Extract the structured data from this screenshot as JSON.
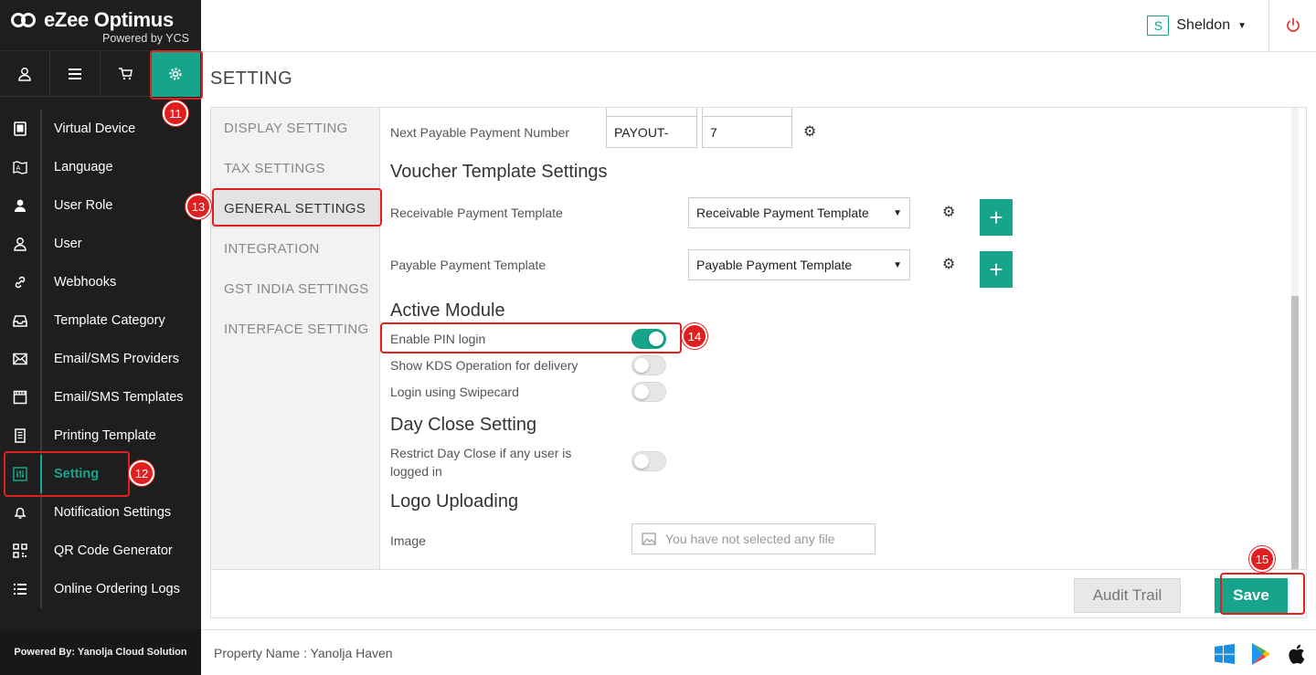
{
  "app": {
    "brand": "eZee Optimus",
    "powered_by": "Powered by YCS",
    "footer": "Powered By: Yanolja Cloud Solution"
  },
  "iconbar": [
    "user-icon",
    "list-icon",
    "cart-icon",
    "gear-icon"
  ],
  "menu": [
    {
      "label": "Virtual Device",
      "icon": "tablet-icon"
    },
    {
      "label": "Language",
      "icon": "language-icon"
    },
    {
      "label": "User Role",
      "icon": "user-role-icon"
    },
    {
      "label": "User",
      "icon": "user-icon"
    },
    {
      "label": "Webhooks",
      "icon": "link-icon"
    },
    {
      "label": "Template Category",
      "icon": "inbox-icon"
    },
    {
      "label": "Email/SMS Providers",
      "icon": "envelope-icon"
    },
    {
      "label": "Email/SMS Templates",
      "icon": "film-icon"
    },
    {
      "label": "Printing Template",
      "icon": "receipt-icon"
    },
    {
      "label": "Setting",
      "icon": "sliders-icon",
      "active": true
    },
    {
      "label": "Notification Settings",
      "icon": "bell-icon"
    },
    {
      "label": "QR Code Generator",
      "icon": "qr-icon"
    },
    {
      "label": "Online Ordering Logs",
      "icon": "list-icon"
    }
  ],
  "topbar": {
    "user_initial": "S",
    "user_name": "Sheldon"
  },
  "page_title": "SETTING",
  "tabs": [
    {
      "label": "DISPLAY SETTING"
    },
    {
      "label": "TAX SETTINGS"
    },
    {
      "label": "GENERAL SETTINGS",
      "active": true
    },
    {
      "label": "INTEGRATION"
    },
    {
      "label": "GST INDIA SETTINGS"
    },
    {
      "label": "INTERFACE SETTING"
    }
  ],
  "content": {
    "next_payable": {
      "label": "Next Payable Payment Number",
      "prefix": "PAYOUT-",
      "number": "7"
    },
    "voucher_title": "Voucher Template Settings",
    "receivable": {
      "label": "Receivable Payment Template",
      "value": "Receivable Payment Template"
    },
    "payable": {
      "label": "Payable Payment Template",
      "value": "Payable Payment Template"
    },
    "active_module_title": "Active Module",
    "pin_login": {
      "label": "Enable PIN login",
      "on": true
    },
    "kds": {
      "label": "Show KDS Operation for delivery",
      "on": false
    },
    "swipecard": {
      "label": "Login using Swipecard",
      "on": false
    },
    "day_close_title": "Day Close Setting",
    "restrict_day_close": {
      "label_line1": "Restrict Day Close if any user is",
      "label_line2": "logged in",
      "on": false
    },
    "logo_title": "Logo Uploading",
    "image": {
      "label": "Image",
      "placeholder": "You have not selected any file"
    }
  },
  "actions": {
    "audit": "Audit Trail",
    "save": "Save"
  },
  "bottombar": {
    "property": "Property Name : Yanolja Haven"
  },
  "annotations": [
    "11",
    "12",
    "13",
    "14",
    "15"
  ],
  "colors": {
    "accent": "#16a58b",
    "highlight": "#e02020"
  }
}
